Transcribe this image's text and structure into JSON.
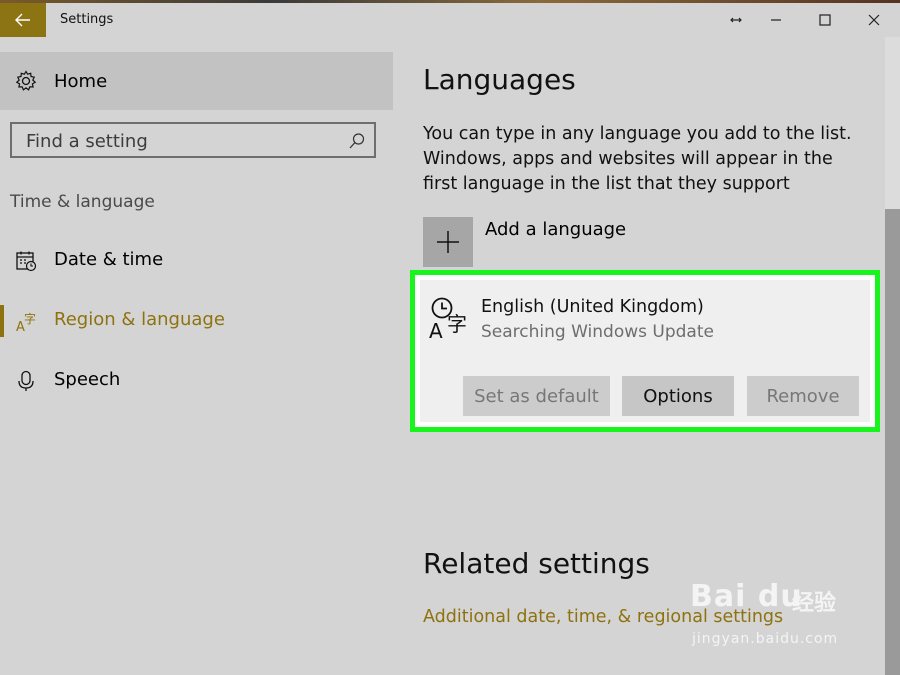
{
  "window": {
    "title": "Settings",
    "controls": {
      "minimize_icon": "minimize-icon",
      "maximize_icon": "maximize-icon",
      "close_icon": "close-icon"
    },
    "accent_color": "#8c7413"
  },
  "sidebar": {
    "home_label": "Home",
    "search_placeholder": "Find a setting",
    "section_header": "Time & language",
    "items": [
      {
        "label": "Date & time",
        "icon": "calendar-clock-icon",
        "selected": false
      },
      {
        "label": "Region & language",
        "icon": "language-icon",
        "selected": true
      },
      {
        "label": "Speech",
        "icon": "microphone-icon",
        "selected": false
      }
    ]
  },
  "main": {
    "title": "Languages",
    "intro": "You can type in any language you add to the list. Windows, apps and websites will appear in the first language in the list that they support",
    "add_language_label": "Add a language",
    "language_card": {
      "name": "English (United Kingdom)",
      "status": "Searching Windows Update",
      "highlight_color": "#17f51c",
      "buttons": {
        "set_default": "Set as default",
        "options": "Options",
        "remove": "Remove"
      }
    },
    "related_title": "Related settings",
    "related_link": "Additional date, time, & regional settings"
  },
  "watermark": {
    "brand": "Bai du",
    "cn": "经验",
    "url": "jingyan.baidu.com"
  }
}
